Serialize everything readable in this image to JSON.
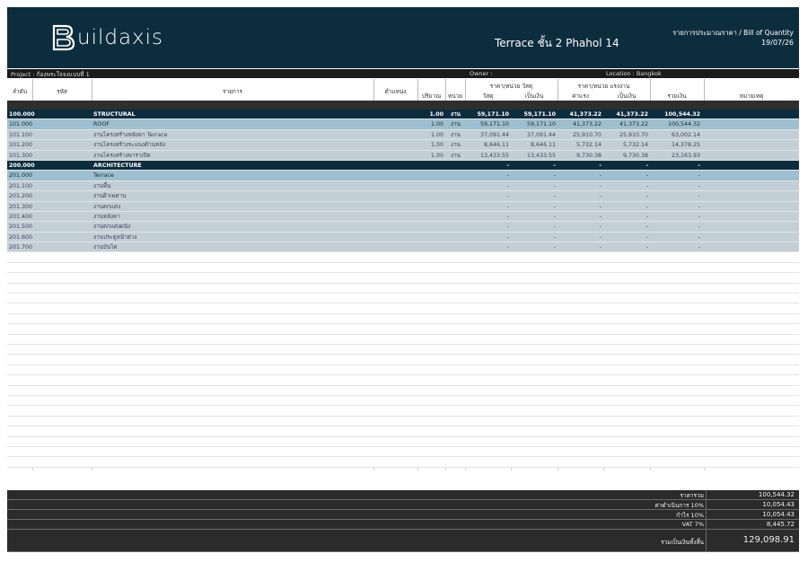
{
  "header": {
    "brand": "uildaxis",
    "title": "Terrace ชั้น 2 Phahol 14",
    "subtitle": "รายการประมาณราคา / Bill of Quantity",
    "date": "19/07/26"
  },
  "project_bar": {
    "project": "Project : ก้องพระใจจงแบบที่ 1",
    "owner": "Owner :",
    "location": "Location : Bangkok"
  },
  "columns": {
    "no": "ลำดับ",
    "code": "รหัส",
    "item": "รายการ",
    "position": "ตำแหน่ง",
    "qty": "ปริมาณ",
    "unit": "หน่วย",
    "material_group": "ราคา/หน่วย วัสดุ",
    "material_unit": "วัสดุ",
    "material_amount": "เป็นเงิน",
    "labor_group": "ราคา/หน่วย แรงงาน",
    "labor_unit": "ค่าแรง",
    "labor_amount": "เป็นเงิน",
    "total": "รวมเงิน",
    "remark": "หมายเหตุ"
  },
  "rows": [
    {
      "type": "sec",
      "no": "100.000",
      "item": "STRUCTURAL",
      "qty": "1.00",
      "unit": "งาน",
      "mu": "59,171.10",
      "ma": "59,171.10",
      "lu": "41,373.22",
      "la": "41,373.22",
      "tot": "100,544.32"
    },
    {
      "type": "sub",
      "no": "101.000",
      "item": "ROOF",
      "qty": "1.00",
      "unit": "งาน",
      "mu": "59,171.10",
      "ma": "59,171.10",
      "lu": "41,373.22",
      "la": "41,373.22",
      "tot": "100,544.32"
    },
    {
      "type": "item",
      "no": "101.100",
      "item": "งานโครงสร้างหลังคา Terrace",
      "qty": "1.00",
      "unit": "งาน",
      "mu": "37,091.44",
      "ma": "37,091.44",
      "lu": "25,910.70",
      "la": "25,910.70",
      "tot": "63,002.14"
    },
    {
      "type": "item",
      "no": "101.200",
      "item": "งานโครงสร้างระแนงด้านหลัง",
      "qty": "1.00",
      "unit": "งาน",
      "mu": "8,646.11",
      "ma": "8,646.11",
      "lu": "5,732.14",
      "la": "5,732.14",
      "tot": "14,378.25"
    },
    {
      "type": "item",
      "no": "101.300",
      "item": "งานโครงสร้างพาราเปิต",
      "qty": "1.00",
      "unit": "งาน",
      "mu": "13,433.55",
      "ma": "13,433.55",
      "lu": "9,730.38",
      "la": "9,730.38",
      "tot": "23,163.93"
    },
    {
      "type": "sec",
      "no": "200.000",
      "item": "ARCHITECTURE",
      "qty": "",
      "unit": "",
      "mu": "-",
      "ma": "-",
      "lu": "-",
      "la": "-",
      "tot": "-"
    },
    {
      "type": "sub",
      "no": "201.000",
      "item": "Terrace",
      "qty": "",
      "unit": "",
      "mu": "-",
      "ma": "-",
      "lu": "-",
      "la": "-",
      "tot": "-"
    },
    {
      "type": "item",
      "no": "201.100",
      "item": "งานพื้น",
      "qty": "",
      "unit": "",
      "mu": "-",
      "ma": "-",
      "lu": "-",
      "la": "-",
      "tot": "-"
    },
    {
      "type": "item",
      "no": "201.200",
      "item": "งานฝ้าเพดาน",
      "qty": "",
      "unit": "",
      "mu": "-",
      "ma": "-",
      "lu": "-",
      "la": "-",
      "tot": "-"
    },
    {
      "type": "item",
      "no": "201.300",
      "item": "งานตกแต่ง",
      "qty": "",
      "unit": "",
      "mu": "-",
      "ma": "-",
      "lu": "-",
      "la": "-",
      "tot": "-"
    },
    {
      "type": "item",
      "no": "201.400",
      "item": "งานหลังคา",
      "qty": "",
      "unit": "",
      "mu": "-",
      "ma": "-",
      "lu": "-",
      "la": "-",
      "tot": "-"
    },
    {
      "type": "item",
      "no": "201.500",
      "item": "งานตกแต่งผนัง",
      "qty": "",
      "unit": "",
      "mu": "-",
      "ma": "-",
      "lu": "-",
      "la": "-",
      "tot": "-"
    },
    {
      "type": "item",
      "no": "201.600",
      "item": "งานประตูหน้าต่าง",
      "qty": "",
      "unit": "",
      "mu": "-",
      "ma": "-",
      "lu": "-",
      "la": "-",
      "tot": "-"
    },
    {
      "type": "item",
      "no": "201.700",
      "item": "งานบันได",
      "qty": "",
      "unit": "",
      "mu": "-",
      "ma": "-",
      "lu": "-",
      "la": "-",
      "tot": "-"
    }
  ],
  "summary": [
    {
      "label": "ราคารวม",
      "value": "100,544.32"
    },
    {
      "label": "ค่าดำเนินการ 10%",
      "value": "10,054.43"
    },
    {
      "label": "กำไร 10%",
      "value": "10,054.43"
    },
    {
      "label": "VAT 7%",
      "value": "8,445.72"
    },
    {
      "label": "รวมเป็นเงินทั้งสิ้น",
      "value": "129,098.91"
    }
  ],
  "colors": {
    "header_bg": "#0c2d3e",
    "section_bg": "#0c2d3e",
    "subsection_bg": "#9ebfcf",
    "item_bg": "#c2cfd6",
    "summary_bg": "#2b2b2b"
  }
}
